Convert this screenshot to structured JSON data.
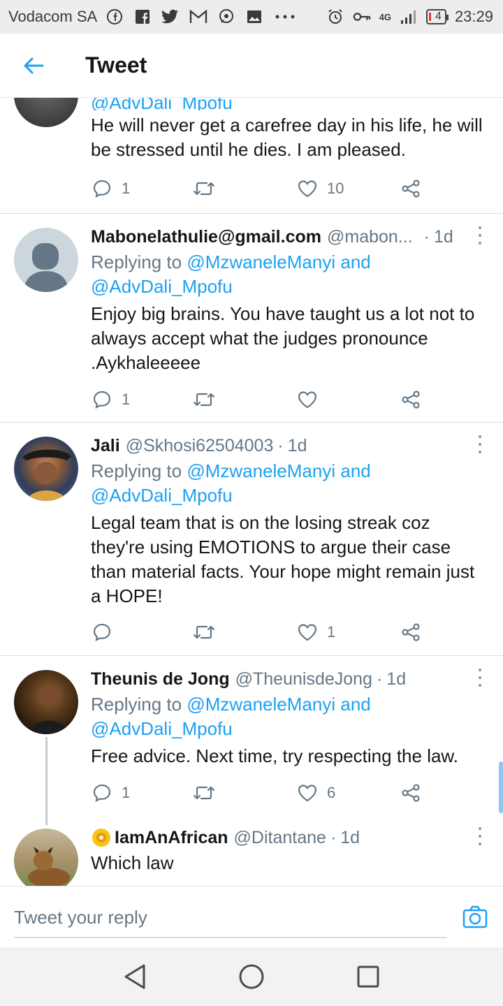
{
  "status_bar": {
    "carrier": "Vodacom SA",
    "network": "4G",
    "battery": "4",
    "time": "23:29",
    "icons": [
      "facebook-icon",
      "facebook-square-icon",
      "twitter-icon",
      "gmail-icon",
      "chat-icon",
      "gallery-icon",
      "more-dots-icon",
      "alarm-icon",
      "key-icon",
      "signal-icon"
    ]
  },
  "header": {
    "title": "Tweet"
  },
  "tweets": [
    {
      "handle_partial": "@AdvDali_Mpofu",
      "text": "He will never get a carefree day in his life, he will be stressed until he dies. I am pleased.",
      "reply_count": "1",
      "retweet_count": "",
      "like_count": "10"
    },
    {
      "name": "Mabonelathulie@gmail.com",
      "handle": "@mabon...",
      "time": "1d",
      "replying_prefix": "Replying to",
      "mention1": "@MzwaneleManyi",
      "and": "and",
      "mention2": "@AdvDali_Mpofu",
      "text": "Enjoy big brains. You have taught us a lot not to always accept what the judges pronounce .Aykhaleeeee",
      "reply_count": "1",
      "retweet_count": "",
      "like_count": ""
    },
    {
      "name": "Jali",
      "handle": "@Skhosi62504003",
      "time": "1d",
      "replying_prefix": "Replying to",
      "mention1": "@MzwaneleManyi",
      "and": "and",
      "mention2": "@AdvDali_Mpofu",
      "text": "Legal team that is on the losing streak coz they're using EMOTIONS to argue their case than material facts. Your hope might remain just a HOPE!",
      "reply_count": "",
      "retweet_count": "",
      "like_count": "1"
    },
    {
      "name": "Theunis de Jong",
      "handle": "@TheunisdeJong",
      "time": "1d",
      "replying_prefix": "Replying to",
      "mention1": "@MzwaneleManyi",
      "and": "and",
      "mention2": "@AdvDali_Mpofu",
      "text": "Free advice. Next time, try respecting the law.",
      "reply_count": "1",
      "retweet_count": "",
      "like_count": "6"
    },
    {
      "name": "IamAnAfrican",
      "handle": "@Ditantane",
      "time": "1d",
      "text": "Which law"
    }
  ],
  "reply_bar": {
    "placeholder": "Tweet your reply"
  },
  "colors": {
    "accent": "#1da1f2",
    "text": "#14171a",
    "muted": "#657786",
    "divider": "#d6dde3"
  }
}
